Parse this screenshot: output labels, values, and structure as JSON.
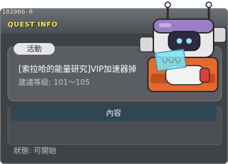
{
  "quest": {
    "id": "102066-0",
    "header_title": "QUEST INFO",
    "category_badge": "活動",
    "name": "[索拉哈的能量研究]VIP加速器掉",
    "recommended_level": "建議等級: 101～105",
    "content_button_label": "內容",
    "status": "狀態: 可開始"
  },
  "npc": {
    "icon": "robot-npc-icon",
    "screen_text": "\\/\\/\\/"
  },
  "colors": {
    "window_bg": "#3f4346",
    "title": "#f2e65d",
    "badge_bg": "#e6e6e6",
    "content_button_bg": "#2f4754"
  }
}
